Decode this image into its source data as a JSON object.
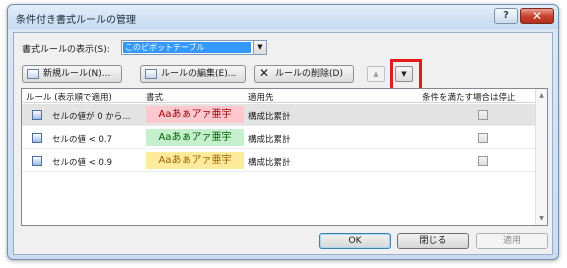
{
  "window": {
    "title": "条件付き書式ルールの管理",
    "help_label": "?",
    "close_label": "✕"
  },
  "scope": {
    "label": "書式ルールの表示(S):",
    "value": "このピボットテーブル",
    "arrow": "▼"
  },
  "toolbar": {
    "new_rule": "新規ルール(N)...",
    "edit_rule": "ルールの編集(E)...",
    "delete_icon_glyph": "✕",
    "delete_rule": "ルールの削除(D)",
    "move_up_glyph": "▲",
    "move_down_glyph": "▼"
  },
  "grid": {
    "columns": [
      "ルール (表示順で適用)",
      "書式",
      "適用先",
      "条件を満たす場合は停止"
    ],
    "rows": [
      {
        "rule": "セルの値が 0 から...",
        "format_sample": "Aaあぁアァ亜宇",
        "applies_to": "構成比累計",
        "stop_if_true": false,
        "selected": true
      },
      {
        "rule": "セルの値 < 0.7",
        "format_sample": "Aaあぁアァ亜宇",
        "applies_to": "構成比累計",
        "stop_if_true": false,
        "selected": false
      },
      {
        "rule": "セルの値 < 0.9",
        "format_sample": "Aaあぁアァ亜宇",
        "applies_to": "構成比累計",
        "stop_if_true": false,
        "selected": false
      }
    ],
    "scroll_up_glyph": "▲",
    "scroll_down_glyph": "▼"
  },
  "colors": {
    "row1_swatch_bg": "#ffc7ce",
    "row1_swatch_fg": "#9c0006",
    "row2_swatch_bg": "#c6efce",
    "row2_swatch_fg": "#006100",
    "row3_swatch_bg": "#ffeb9c",
    "row3_swatch_fg": "#9c6500",
    "highlight": "#e31b1b"
  },
  "buttons": {
    "ok": "OK",
    "close": "閉じる",
    "apply": "適用"
  }
}
